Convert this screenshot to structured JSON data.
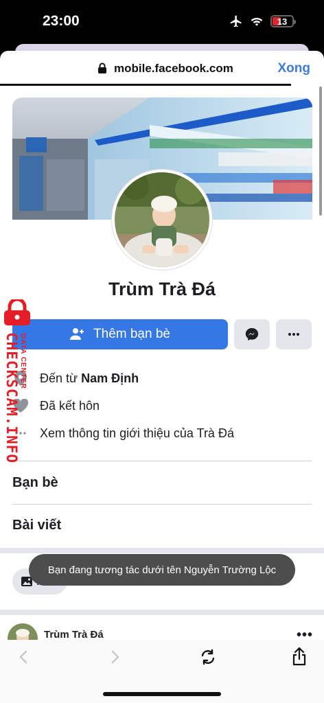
{
  "status_bar": {
    "time": "23:00",
    "battery": "13"
  },
  "browser": {
    "url": "mobile.facebook.com",
    "done_label": "Xong"
  },
  "profile": {
    "name": "Trùm Trà Đá",
    "add_friend_label": "Thêm bạn bè",
    "info": {
      "from_prefix": "Đến từ ",
      "from_place": "Nam Định",
      "relationship": "Đã kết hôn",
      "see_intro": "Xem thông tin giới thiệu của Trà Đá"
    },
    "friends_title": "Bạn bè",
    "posts_title": "Bài viết",
    "photos_chip": "Ảnh"
  },
  "toast": "Bạn đang tương tác dưới tên Nguyễn Trường Lộc",
  "post": {
    "author": "Trùm Trà Đá",
    "more": "•••"
  },
  "watermark": {
    "main": "CHECKSCAM.INFO",
    "sub": "DATA CENTER"
  },
  "colors": {
    "fb_blue": "#3578e5",
    "done_blue": "#3d7bd9",
    "watermark_red": "#e41e26"
  }
}
